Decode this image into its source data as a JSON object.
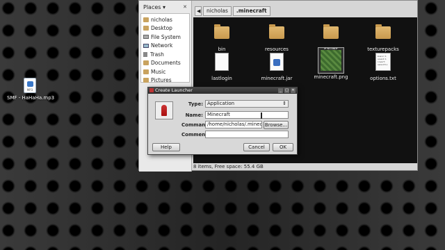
{
  "desktop": {
    "file_label": "SMF - HaHaHa.mp3",
    "file_icon_text": "MP3"
  },
  "places": {
    "title": "Places",
    "close": "✕",
    "dropdown": "▾",
    "items": [
      {
        "label": "nicholas",
        "icon": "folder-icon"
      },
      {
        "label": "Desktop",
        "icon": "folder-icon"
      },
      {
        "label": "File System",
        "icon": "drive-icon"
      },
      {
        "label": "Network",
        "icon": "network-icon"
      },
      {
        "label": "Trash",
        "icon": "trash-icon"
      },
      {
        "label": "Documents",
        "icon": "folder-icon"
      },
      {
        "label": "Music",
        "icon": "folder-icon"
      },
      {
        "label": "Pictures",
        "icon": "folder-icon"
      }
    ]
  },
  "pathbar": {
    "back": "◀",
    "crumbs": [
      "nicholas",
      ".minecraft"
    ]
  },
  "files": [
    {
      "name": "bin",
      "type": "folder"
    },
    {
      "name": "resources",
      "type": "folder"
    },
    {
      "name": "saves",
      "type": "folder"
    },
    {
      "name": "texturepacks",
      "type": "folder"
    },
    {
      "name": "lastlogin",
      "type": "file"
    },
    {
      "name": "minecraft.jar",
      "type": "jar"
    },
    {
      "name": "minecraft.png",
      "type": "image"
    },
    {
      "name": "options.txt",
      "type": "text",
      "preview": "music:1 sound:1 invert sensitiv"
    }
  ],
  "status": "8 items, Free space: 55.4 GB",
  "dialog": {
    "title": "Create Launcher",
    "controls": [
      "_",
      "□",
      "✕"
    ],
    "type_label": "Type:",
    "type_value": "Application",
    "type_arrow": "⇕",
    "name_label": "Name:",
    "name_value": "Minecraft",
    "command_label": "Command:",
    "command_value": "/home/nicholas/.minec",
    "comment_label": "Comment:",
    "comment_value": "",
    "browse": "Browse...",
    "help": "Help",
    "cancel": "Cancel",
    "ok": "OK"
  },
  "colors": {
    "launcher_icon": "#c33333",
    "folder": "#c99a4e"
  }
}
